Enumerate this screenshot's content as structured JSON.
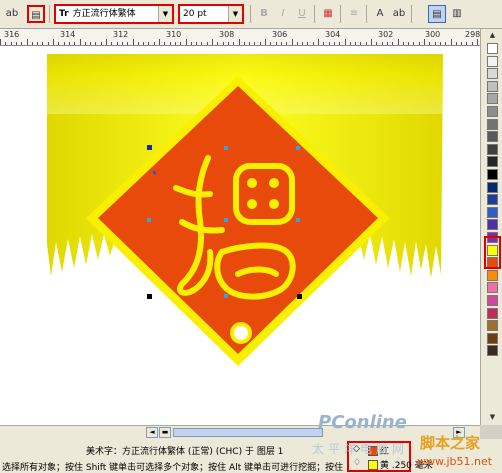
{
  "toolbar": {
    "font_name": "方正流行体繁体",
    "font_size": "20 pt",
    "font_type_glyph": "Tr",
    "tools": [
      {
        "name": "align-icon",
        "glyph": "⊟"
      },
      {
        "name": "text-frame-icon",
        "glyph": "▤"
      },
      {
        "name": "bold-icon",
        "glyph": "B"
      },
      {
        "name": "italic-icon",
        "glyph": "I"
      },
      {
        "name": "underline-icon",
        "glyph": "U"
      },
      {
        "name": "character-format-icon",
        "glyph": "▦"
      },
      {
        "name": "horizontal-text-icon",
        "glyph": "A"
      },
      {
        "name": "vertical-text-icon",
        "glyph": "▥"
      },
      {
        "name": "text-properties-icon",
        "glyph": "▣"
      },
      {
        "name": "edit-text-icon",
        "glyph": "ab"
      }
    ]
  },
  "ruler": {
    "labels": [
      "316",
      "314",
      "312",
      "310",
      "308",
      "306",
      "304",
      "302",
      "300",
      "298"
    ]
  },
  "artwork": {
    "character": "福",
    "colors": {
      "background_gold": "#f2ee08",
      "diamond_red": "#e84a0c",
      "border_yellow": "#f8f000",
      "hole": "#ffffff"
    }
  },
  "palette": {
    "colors": [
      "#ffffff",
      "#f2f2f2",
      "#d9d9d9",
      "#bfbfbf",
      "#a6a6a6",
      "#8c8c8c",
      "#737373",
      "#595959",
      "#404040",
      "#262626",
      "#000000",
      "#002a6e",
      "#1b3f99",
      "#2d5fc9",
      "#4f2fa8",
      "#7e2fa3",
      "#ffff00",
      "#e84a0c",
      "#ff8c00",
      "#f06fa8",
      "#d0479c",
      "#c02c58",
      "#9c6f2d",
      "#6e3e12",
      "#3a2a20"
    ]
  },
  "status": {
    "object_info": "美术字：方正流行体繁体 (正常) (CHC) 于 图层 1",
    "hint": "选择所有对象；按住 Shift 键单击可选择多个对象；按住 Alt 键单击可进行挖掘；按住",
    "legend": [
      {
        "glyph": "◇",
        "label": "红",
        "color": "#e84a0c"
      },
      {
        "glyph": "♢",
        "label": "黄 .250 毫米",
        "color": "#ffff00"
      }
    ]
  },
  "watermarks": {
    "pconline": "PConline",
    "pconline_sub": "太平洋电脑网",
    "jb51_top": "脚本之家",
    "jb51_bottom": "www.jb51.net"
  }
}
